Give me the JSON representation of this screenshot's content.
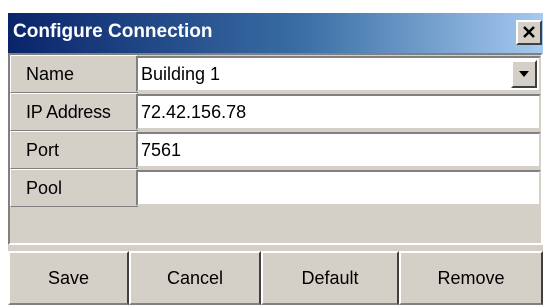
{
  "window": {
    "title": "Configure Connection",
    "close_icon": "close-icon"
  },
  "form": {
    "name_label": "Name",
    "name_value": "Building 1",
    "ip_label": "IP Address",
    "ip_value": "72.42.156.78",
    "port_label": "Port",
    "port_value": "7561",
    "pool_label": "Pool",
    "pool_value": ""
  },
  "buttons": {
    "save": "Save",
    "cancel": "Cancel",
    "default": "Default",
    "remove": "Remove"
  },
  "colors": {
    "title_gradient_start": "#0a246a",
    "title_gradient_end": "#a6caf0",
    "dialog_face": "#d4d0c8"
  }
}
